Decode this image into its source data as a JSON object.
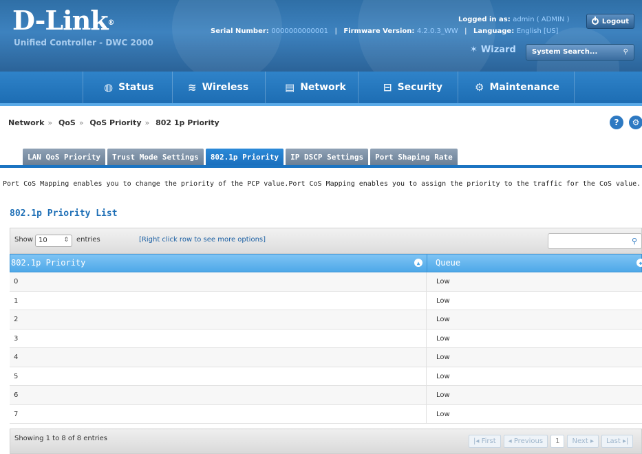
{
  "header": {
    "brand": "D-Link",
    "subtitle": "Unified Controller - DWC 2000",
    "serial_label": "Serial Number:",
    "serial_value": "0000000000001",
    "firmware_label": "Firmware Version:",
    "firmware_value": "4.2.0.3_WW",
    "language_label": "Language:",
    "language_value": "English [US]",
    "logged_label": "Logged in as:",
    "logged_value": "admin ( ADMIN )",
    "logout_label": "Logout",
    "wizard_label": "Wizard",
    "search_placeholder": "System Search..."
  },
  "nav": [
    {
      "label": "Status",
      "icon": "status-icon"
    },
    {
      "label": "Wireless",
      "icon": "wifi-icon"
    },
    {
      "label": "Network",
      "icon": "network-icon"
    },
    {
      "label": "Security",
      "icon": "lock-icon"
    },
    {
      "label": "Maintenance",
      "icon": "gear-icon"
    }
  ],
  "breadcrumb": [
    "Network",
    "QoS",
    "QoS Priority",
    "802 1p Priority"
  ],
  "tabs": [
    "LAN QoS Priority",
    "Trust Mode Settings",
    "802.1p Priority",
    "IP DSCP Settings",
    "Port Shaping Rate"
  ],
  "description": "Port CoS Mapping enables you to change the priority of the PCP value.Port CoS Mapping enables you to assign the priority to the traffic for the CoS value.",
  "list_title": "802.1p Priority List",
  "table": {
    "show_label": "Show",
    "page_length": "10",
    "entries_label": "entries",
    "hint": "[Right click row to see more options]",
    "columns": [
      "802.1p Priority",
      "Queue"
    ],
    "rows": [
      [
        "0",
        "Low"
      ],
      [
        "1",
        "Low"
      ],
      [
        "2",
        "Low"
      ],
      [
        "3",
        "Low"
      ],
      [
        "4",
        "Low"
      ],
      [
        "5",
        "Low"
      ],
      [
        "6",
        "Low"
      ],
      [
        "7",
        "Low"
      ]
    ],
    "info": "Showing 1 to 8 of 8 entries",
    "pager": {
      "first": "First",
      "previous": "Previous",
      "page": "1",
      "next": "Next",
      "last": "Last"
    }
  },
  "colors": {
    "nav_bg": "#1d6db3",
    "active_tab": "#1b6fbd",
    "table_header": "#4ea8e8",
    "list_title": "#1e6fb6"
  }
}
